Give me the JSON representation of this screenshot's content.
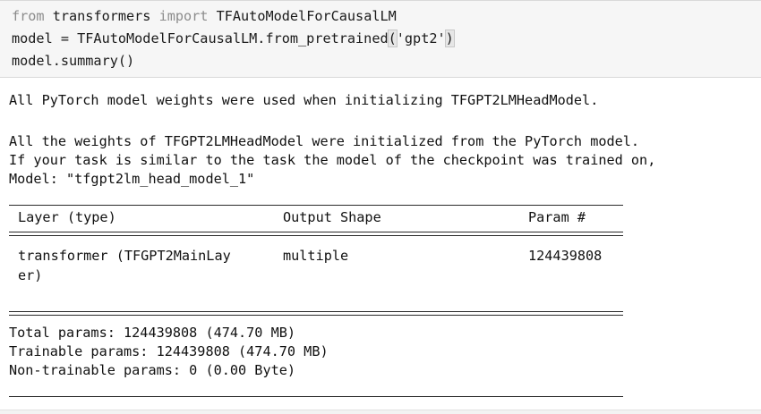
{
  "code": {
    "line1": {
      "kw_from": "from",
      "module": " transformers ",
      "kw_import": "import",
      "name": " TFAutoModelForCausalLM"
    },
    "line2": {
      "prefix": "model = TFAutoModelForCausalLM.from_pretrained",
      "open_paren": "(",
      "arg": "'gpt2'",
      "close_paren": ")"
    },
    "line3": "model.summary()"
  },
  "output": {
    "msg1": "All PyTorch model weights were used when initializing TFGPT2LMHeadModel.",
    "msg2": "All the weights of TFGPT2LMHeadModel were initialized from the PyTorch model.",
    "msg3": "If your task is similar to the task the model of the checkpoint was trained on,",
    "model_line": "Model: \"tfgpt2lm_head_model_1\"",
    "table": {
      "headers": {
        "layer": "Layer (type)",
        "output_shape": "Output Shape",
        "params": "Param #"
      },
      "rows": [
        {
          "layer_line1": "transformer (TFGPT2MainLay",
          "layer_line2": "er)",
          "output_shape": "multiple",
          "params": "124439808"
        }
      ]
    },
    "totals": {
      "total": "Total params: 124439808 (474.70 MB)",
      "trainable": "Trainable params: 124439808 (474.70 MB)",
      "non_trainable": "Non-trainable params: 0 (0.00 Byte)"
    }
  }
}
